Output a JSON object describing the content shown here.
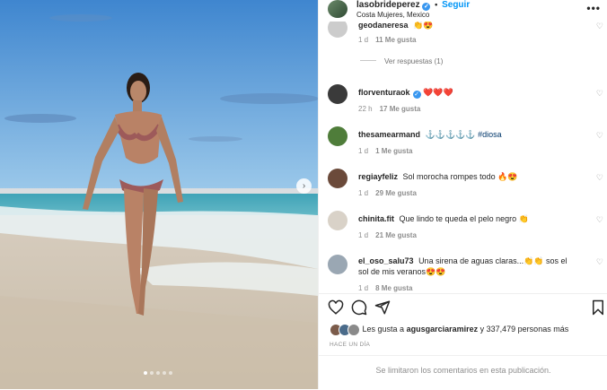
{
  "post": {
    "username": "lasobrideperez",
    "follow_label": "Seguir",
    "location": "Costa Mujeres, Mexico",
    "more_label": "•••",
    "carousel_next_icon": "chevron-right-icon"
  },
  "comments": [
    {
      "user": "geodaneresa",
      "text": "👏😍",
      "time": "1 d",
      "likes": "11 Me gusta",
      "replies": "Ver respuestas (1)"
    },
    {
      "user": "florventuraok",
      "verified": true,
      "text": "❤️❤️❤️",
      "time": "22 h",
      "likes": "17 Me gusta"
    },
    {
      "user": "thesamearmand",
      "text": "⚓⚓⚓⚓⚓",
      "hashtag": "#diosa",
      "time": "1 d",
      "likes": "1 Me gusta"
    },
    {
      "user": "regiayfeliz",
      "text": "Sol morocha rompes todo 🔥😍",
      "time": "1 d",
      "likes": "29 Me gusta"
    },
    {
      "user": "chinita.fit",
      "text": "Que lindo te queda el pelo negro 👏",
      "time": "1 d",
      "likes": "21 Me gusta"
    },
    {
      "user": "el_oso_salu73",
      "text": "Una sirena de aguas claras...👏👏 sos el sol de mis veranos😍😍",
      "time": "1 d",
      "likes": "8 Me gusta"
    }
  ],
  "footer": {
    "likes_prefix": "Les gusta a",
    "likes_user": "agusgarciaramirez",
    "likes_suffix": "y 337,479 personas más",
    "date": "HACE UN DÍA",
    "comments_limited": "Se limitaron los comentarios en esta publicación."
  }
}
